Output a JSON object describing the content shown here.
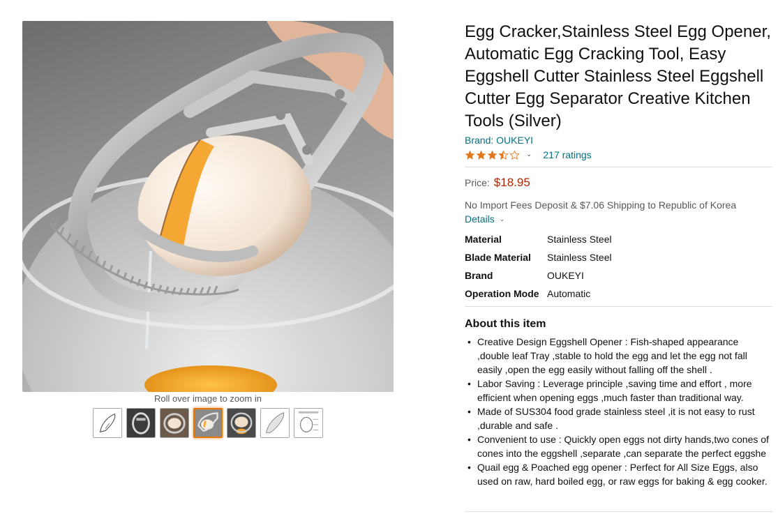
{
  "product": {
    "title": "Egg Cracker,Stainless Steel Egg Opener, Automatic Egg Cracking Tool, Easy Eggshell Cutter Stainless Steel Eggshell Cutter Egg Separator Creative Kitchen Tools (Silver)",
    "brand_label": "Brand: OUKEYI",
    "rating": 3.5,
    "ratings_count": "217 ratings",
    "price_label": "Price:",
    "price": "$18.95",
    "shipping": "No Import Fees Deposit & $7.06 Shipping to Republic of Korea",
    "details_label": "Details"
  },
  "gallery": {
    "zoom_hint": "Roll over image to zoom in",
    "selected_index": 3,
    "thumbnail_count": 7
  },
  "specs": [
    {
      "key": "Material",
      "value": "Stainless Steel"
    },
    {
      "key": "Blade Material",
      "value": "Stainless Steel"
    },
    {
      "key": "Brand",
      "value": "OUKEYI"
    },
    {
      "key": "Operation Mode",
      "value": "Automatic"
    }
  ],
  "about": {
    "title": "About this item",
    "bullets": [
      "Creative Design Eggshell Opener : Fish-shaped appearance ,double leaf Tray ,stable to hold the egg and let the egg not fall easily ,open the egg easily without falling off the shell .",
      "Labor Saving : Leverage principle ,saving time and effort , more efficient when opening eggs ,much faster than traditional way.",
      "Made of SUS304 food grade stainless steel ,it is not easy to rust ,durable and safe .",
      "Convenient to use : Quickly open eggs not dirty hands,two cones of cones into the eggshell ,separate ,can separate the perfect eggshe",
      "Quail egg & Poached egg opener : Perfect for All Size Eggs, also used on raw, hard boiled egg, or raw eggs for baking & egg cooker."
    ]
  },
  "icons": {
    "star": "star-icon",
    "chevron": "chevron-down-icon"
  },
  "colors": {
    "link": "#007185",
    "price": "#b12704",
    "star": "#de7921",
    "thumb_selected": "#e77600"
  }
}
